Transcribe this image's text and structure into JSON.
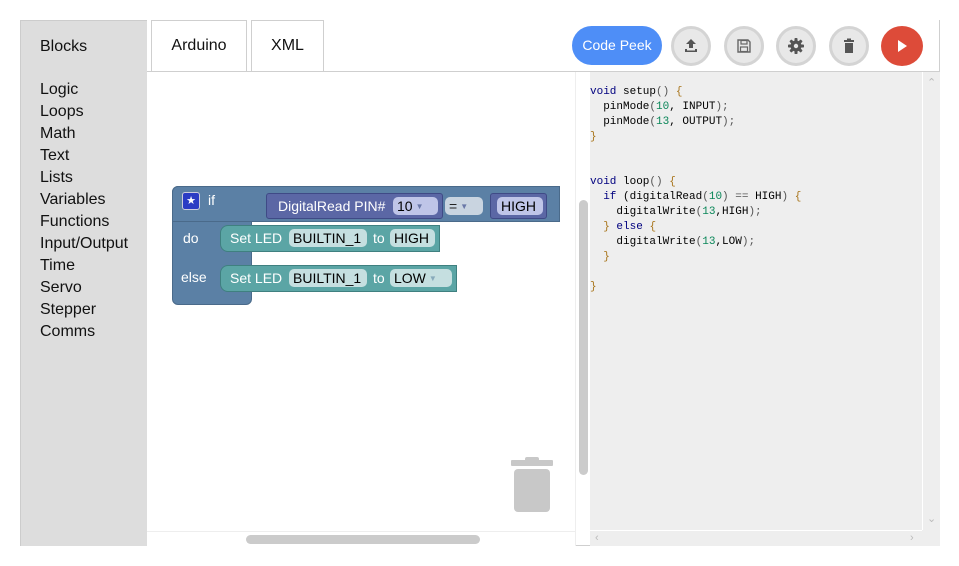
{
  "toolbox": {
    "title": "Blocks",
    "categories": [
      "Logic",
      "Loops",
      "Math",
      "Text",
      "Lists",
      "Variables",
      "Functions",
      "Input/Output",
      "Time",
      "Servo",
      "Stepper",
      "Comms"
    ]
  },
  "tabs": [
    {
      "label": "Arduino"
    },
    {
      "label": "XML"
    }
  ],
  "toolbar": {
    "code_peek_label": "Code Peek",
    "buttons": [
      "upload-icon",
      "save-icon",
      "settings-icon",
      "delete-icon",
      "run-icon"
    ],
    "colors": {
      "code_peek": "#4e8ef7",
      "run": "#dd4b39"
    }
  },
  "blocks": {
    "if_label": "if",
    "do_label": "do",
    "else_label": "else",
    "condition": {
      "read_label": "DigitalRead PIN#",
      "pin": "10",
      "operator": "=",
      "value": "HIGH"
    },
    "do_stmt": {
      "label": "Set LED",
      "led": "BUILTIN_1",
      "to": "to",
      "value": "HIGH"
    },
    "else_stmt": {
      "label": "Set LED",
      "led": "BUILTIN_1",
      "to": "to",
      "value": "LOW"
    }
  },
  "code": {
    "lines": [
      "void setup() {",
      "  pinMode(10, INPUT);",
      "  pinMode(13, OUTPUT);",
      "}",
      "",
      "",
      "void loop() {",
      "  if (digitalRead(10) == HIGH) {",
      "    digitalWrite(13,HIGH);",
      "  } else {",
      "    digitalWrite(13,LOW);",
      "  }",
      "",
      "}"
    ]
  }
}
